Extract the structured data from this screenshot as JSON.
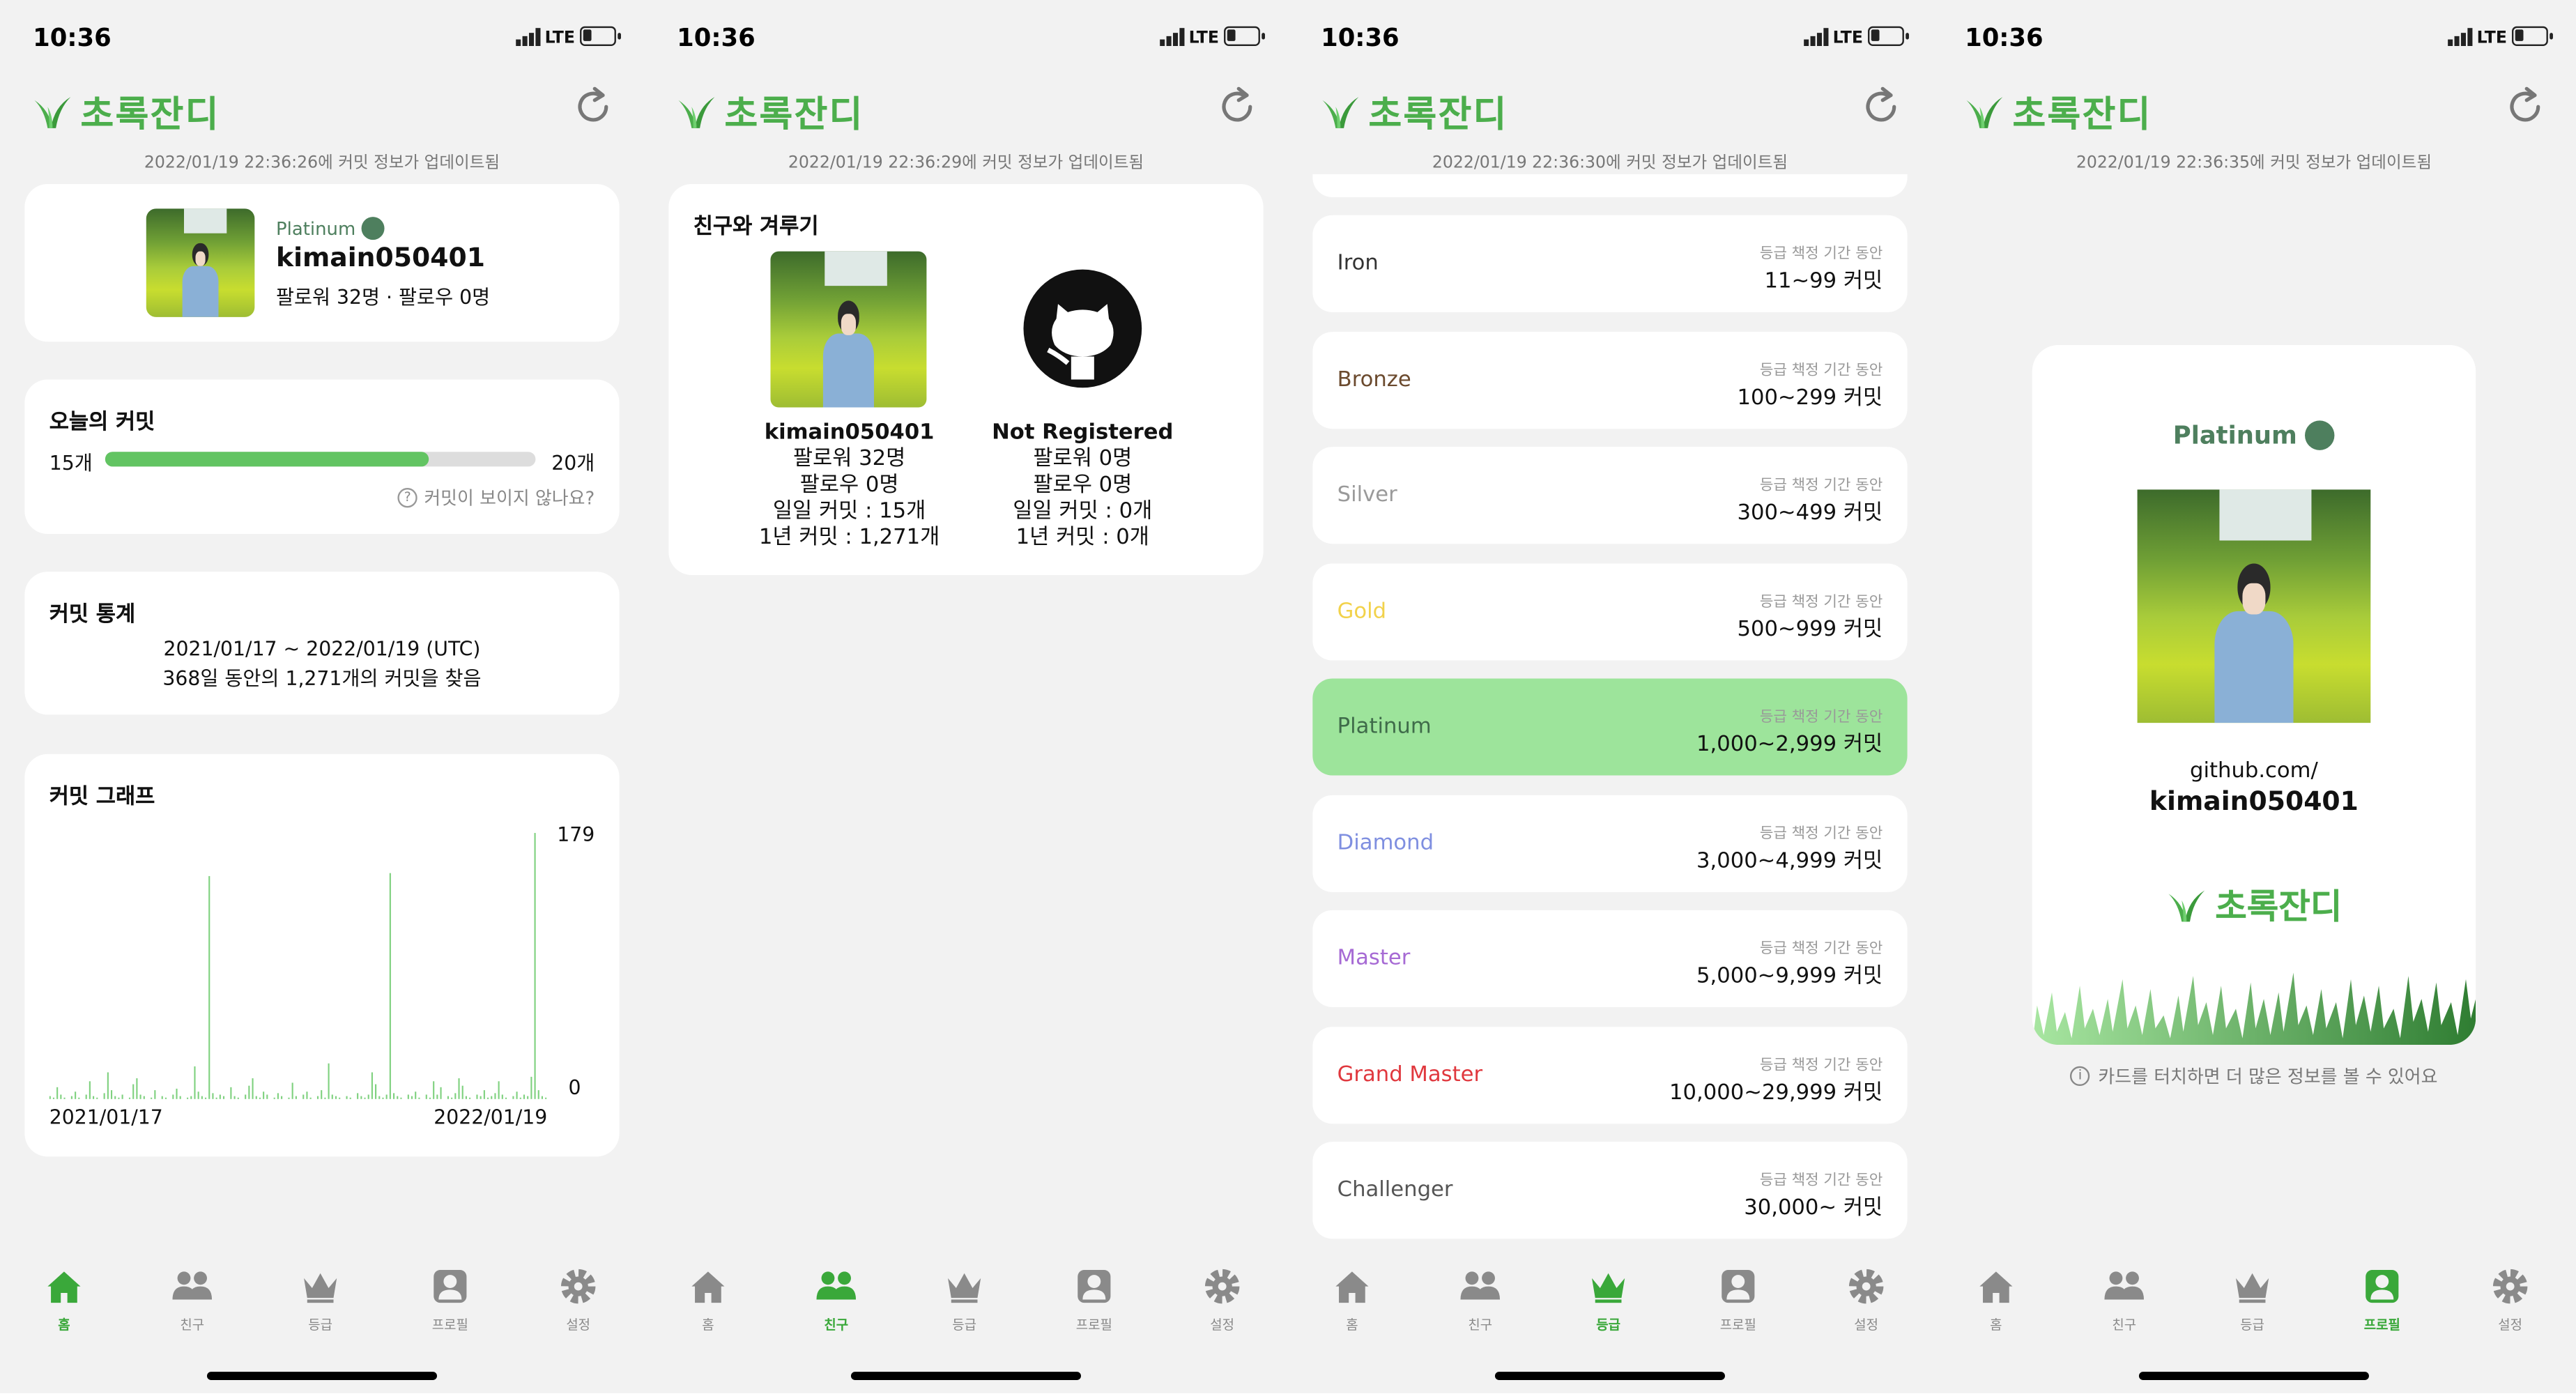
{
  "status": {
    "time": "10:36",
    "network": "LTE"
  },
  "app": {
    "title": "초록잔디"
  },
  "tabs": [
    {
      "label": "홈",
      "icon": "home-icon"
    },
    {
      "label": "친구",
      "icon": "friends-icon"
    },
    {
      "label": "등급",
      "icon": "crown-icon"
    },
    {
      "label": "프로필",
      "icon": "profile-icon"
    },
    {
      "label": "설정",
      "icon": "gear-icon"
    }
  ],
  "screen1": {
    "updated": "2022/01/19 22:36:26에 커밋 정보가 업데이트됨",
    "profile": {
      "tier": "Platinum",
      "username": "kimain050401",
      "follow": "팔로워 32명 · 팔로우 0명"
    },
    "today": {
      "title": "오늘의 커밋",
      "current": "15개",
      "goal": "20개",
      "progress": 0.75,
      "help": "커밋이 보이지 않나요?"
    },
    "stats": {
      "title": "커밋 통계",
      "range": "2021/01/17 ~ 2022/01/19 (UTC)",
      "summary": "368일 동안의 1,271개의 커밋을 찾음"
    },
    "graph": {
      "title": "커밋 그래프",
      "ymax": "179",
      "ymin": "0",
      "xstart": "2021/01/17",
      "xend": "2022/01/19"
    }
  },
  "chart_data": {
    "type": "bar",
    "title": "커밋 그래프",
    "xlabel": "",
    "ylabel": "",
    "x_range": [
      "2021/01/17",
      "2022/01/19"
    ],
    "ylim": [
      0,
      179
    ],
    "values": [
      2,
      1,
      8,
      3,
      1,
      0,
      2,
      5,
      1,
      0,
      3,
      12,
      2,
      1,
      0,
      4,
      18,
      6,
      2,
      1,
      3,
      0,
      1,
      10,
      14,
      3,
      2,
      0,
      1,
      6,
      0,
      2,
      1,
      0,
      3,
      7,
      2,
      0,
      1,
      2,
      22,
      5,
      2,
      1,
      150,
      4,
      1,
      3,
      2,
      0,
      8,
      2,
      1,
      0,
      3,
      9,
      14,
      2,
      1,
      5,
      3,
      0,
      1,
      4,
      2,
      0,
      1,
      11,
      2,
      0,
      3,
      5,
      1,
      0,
      2,
      6,
      1,
      24,
      3,
      2,
      1,
      0,
      2,
      1,
      0,
      4,
      2,
      1,
      3,
      18,
      10,
      2,
      1,
      3,
      152,
      4,
      2,
      1,
      0,
      3,
      2,
      5,
      1,
      0,
      3,
      1,
      12,
      3,
      8,
      0,
      2,
      1,
      4,
      14,
      9,
      2,
      1,
      0,
      3,
      2,
      6,
      1,
      2,
      4,
      12,
      3,
      1,
      0,
      2,
      5,
      1,
      3,
      2,
      15,
      179,
      6,
      2,
      1
    ]
  },
  "screen2": {
    "updated": "2022/01/19 22:36:29에 커밋 정보가 업데이트됨",
    "title": "친구와 겨루기",
    "left": {
      "name": "kimain050401",
      "followers": "팔로워 32명",
      "following": "팔로우 0명",
      "daily": "일일 커밋 : 15개",
      "yearly": "1년 커밋 : 1,271개"
    },
    "right": {
      "name": "Not Registered",
      "followers": "팔로워 0명",
      "following": "팔로우 0명",
      "daily": "일일 커밋 : 0개",
      "yearly": "1년 커밋 : 0개"
    }
  },
  "screen3": {
    "updated": "2022/01/19 22:36:30에 커밋 정보가 업데이트됨",
    "period_label": "등급 책정 기간 동안",
    "tiers": [
      {
        "name": "Iron",
        "range": "11~99 커밋",
        "color": "#333333"
      },
      {
        "name": "Bronze",
        "range": "100~299 커밋",
        "color": "#6b4a2e"
      },
      {
        "name": "Silver",
        "range": "300~499 커밋",
        "color": "#9a9a9a"
      },
      {
        "name": "Gold",
        "range": "500~999 커밋",
        "color": "#f2d24b"
      },
      {
        "name": "Platinum",
        "range": "1,000~2,999 커밋",
        "color": "#3f6b4a",
        "highlight": "#9de49b"
      },
      {
        "name": "Diamond",
        "range": "3,000~4,999 커밋",
        "color": "#7f8fe0"
      },
      {
        "name": "Master",
        "range": "5,000~9,999 커밋",
        "color": "#a66ad4"
      },
      {
        "name": "Grand Master",
        "range": "10,000~29,999 커밋",
        "color": "#e0383e"
      },
      {
        "name": "Challenger",
        "range": "30,000~ 커밋",
        "color": "#555555"
      }
    ]
  },
  "screen4": {
    "updated": "2022/01/19 22:36:35에 커밋 정보가 업데이트됨",
    "tier": "Platinum",
    "link_prefix": "github.com/",
    "username": "kimain050401",
    "hint": "카드를 터치하면 더 많은 정보를 볼 수 있어요"
  },
  "colors": {
    "accent": "#4cae4c",
    "progress": "#62c462",
    "platinum_badge": "#4e7f5e"
  }
}
